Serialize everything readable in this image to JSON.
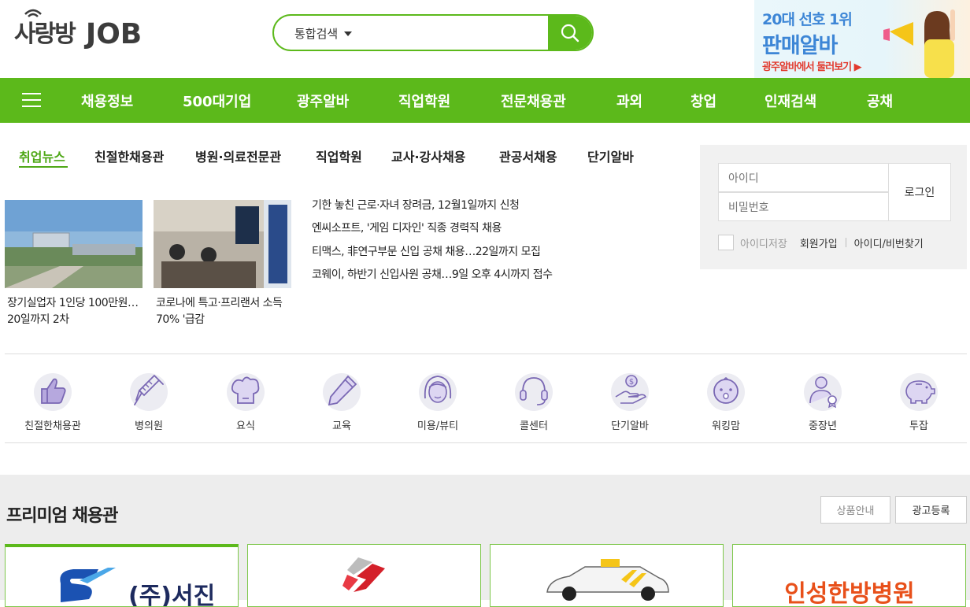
{
  "header": {
    "logo_ko": "사랑방",
    "logo_en": "JOB",
    "search": {
      "scope": "통합검색",
      "value": "",
      "placeholder": ""
    },
    "banner": {
      "line1": "20대 선호 1위",
      "line2": "판매알바",
      "line3": "광주알바에서 둘러보기 ▶"
    }
  },
  "gnb": {
    "items": [
      "채용정보",
      "500대기업",
      "광주알바",
      "직업학원",
      "전문채용관",
      "과외",
      "창업",
      "인재검색",
      "공채"
    ]
  },
  "news": {
    "tabs": [
      "취업뉴스",
      "친절한채용관",
      "병원·의료전문관",
      "직업학원",
      "교사·강사채용",
      "관공서채용",
      "단기알바"
    ],
    "active_tab": "취업뉴스",
    "thumbs": [
      {
        "caption": "장기실업자 1인당 100만원…20일까지 2차"
      },
      {
        "caption": "코로나에 특고·프리랜서 소득 70% '급감"
      }
    ],
    "headlines": [
      "기한 놓친 근로·자녀 장려금, 12월1일까지 신청",
      "엔씨소프트, '게임 디자인' 직종 경력직 채용",
      "티맥스, 非연구부문 신입 공채 채용…22일까지 모집",
      "코웨이, 하반기 신입사원 공채…9일 오후 4시까지 접수"
    ]
  },
  "login": {
    "id_placeholder": "아이디",
    "pw_placeholder": "비밀번호",
    "login_label": "로그인",
    "remember_label": "아이디저장",
    "join_label": "회원가입",
    "find_label": "아이디/비번찾기"
  },
  "categories": [
    {
      "label": "친절한채용관",
      "icon": "thumbs-up-icon"
    },
    {
      "label": "병의원",
      "icon": "syringe-icon"
    },
    {
      "label": "요식",
      "icon": "chef-hat-icon"
    },
    {
      "label": "교육",
      "icon": "pencil-icon"
    },
    {
      "label": "미용/뷰티",
      "icon": "woman-face-icon"
    },
    {
      "label": "콜센터",
      "icon": "headset-icon"
    },
    {
      "label": "단기알바",
      "icon": "hand-coin-icon"
    },
    {
      "label": "워킹맘",
      "icon": "baby-icon"
    },
    {
      "label": "중장년",
      "icon": "senior-person-icon"
    },
    {
      "label": "투잡",
      "icon": "piggy-bank-icon"
    }
  ],
  "premium": {
    "title": "프리미엄 채용관",
    "product_info_label": "상품안내",
    "ad_register_label": "광고등록",
    "cards": [
      {
        "name": "(주)서진"
      },
      {
        "name": ""
      },
      {
        "name": ""
      },
      {
        "name": "인성한방병원"
      }
    ]
  },
  "colors": {
    "brand_green": "#5cb91b",
    "active_tab": "#4fa817",
    "icon_purple": "#8a7ab8"
  }
}
